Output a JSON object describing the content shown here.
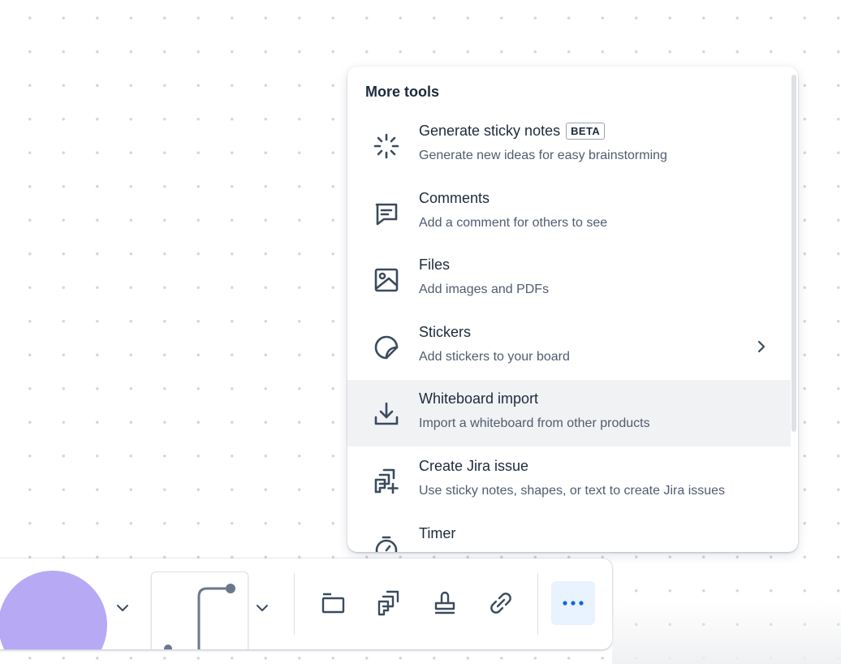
{
  "menu": {
    "title": "More tools",
    "items": [
      {
        "title": "Generate sticky notes",
        "badge": "BETA",
        "description": "Generate new ideas for easy brainstorming",
        "icon": "sparkle-burst-icon"
      },
      {
        "title": "Comments",
        "description": "Add a comment for others to see",
        "icon": "comment-icon"
      },
      {
        "title": "Files",
        "description": "Add images and PDFs",
        "icon": "image-icon"
      },
      {
        "title": "Stickers",
        "description": "Add stickers to your board",
        "icon": "sticker-icon",
        "has_submenu": true
      },
      {
        "title": "Whiteboard import",
        "description": "Import a whiteboard from other products",
        "icon": "download-icon",
        "highlighted": true
      },
      {
        "title": "Create Jira issue",
        "description": "Use sticky notes, shapes, or text to create Jira issues",
        "icon": "jira-create-icon"
      },
      {
        "title": "Timer",
        "description": "",
        "icon": "stopwatch-icon"
      }
    ]
  },
  "toolbar": {
    "shape_color": "#b8a9f5",
    "buttons": [
      {
        "name": "frame",
        "icon": "frame-icon"
      },
      {
        "name": "jira",
        "icon": "jira-icon"
      },
      {
        "name": "stamp",
        "icon": "stamp-icon"
      },
      {
        "name": "link",
        "icon": "link-icon"
      },
      {
        "name": "more",
        "icon": "more-dots-icon",
        "selected": true
      }
    ]
  },
  "colors": {
    "accent": "#0c66e4",
    "highlight_bg": "#f1f2f4",
    "selected_bg": "#e9f2ff",
    "text_primary": "#1d2a3d",
    "text_secondary": "#505c6f"
  }
}
